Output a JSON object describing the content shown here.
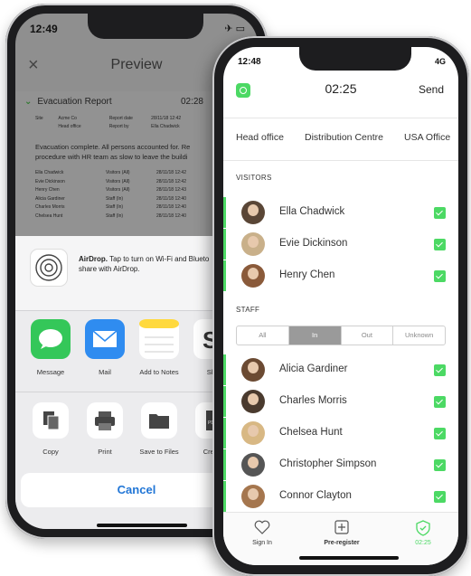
{
  "back_phone": {
    "status_time": "12:49",
    "status_right": "✈ ▭",
    "header": {
      "close": "×",
      "title": "Preview"
    },
    "report": {
      "title": "Evacuation Report",
      "time": "02:28",
      "meta": {
        "site_label": "Site",
        "site_value": "Acme Co",
        "report_date_label": "Report date",
        "report_date": "28/11/18 12:42",
        "office": "Head office",
        "reported_by_label": "Report by",
        "reported_by": "Ella Chadwick"
      },
      "summary_line1": "Evacuation complete. All persons accounted for. Re",
      "summary_line2": "procedure with HR team as slow to leave the buildi",
      "entries": [
        {
          "name": "Ella Chadwick",
          "type": "Visitors (All)",
          "time": "28/11/18 12:42"
        },
        {
          "name": "Evie Dickinson",
          "type": "Visitors (All)",
          "time": "28/11/18 12:42"
        },
        {
          "name": "Henry Chen",
          "type": "Visitors (All)",
          "time": "28/11/18 12:43"
        },
        {
          "name": "Alicia Gardiner",
          "type": "Staff (In)",
          "time": "28/11/18 12:40"
        },
        {
          "name": "Charles Morris",
          "type": "Staff (In)",
          "time": "28/11/18 12:40"
        },
        {
          "name": "Chelsea Hunt",
          "type": "Staff (In)",
          "time": "28/11/18 12:40"
        }
      ]
    },
    "airdrop": {
      "title": "AirDrop.",
      "text": "Tap to turn on Wi-Fi and Blueto",
      "text2": "share with AirDrop."
    },
    "apps": [
      {
        "label": "Message",
        "color": "#34c759"
      },
      {
        "label": "Mail",
        "color": "#2f8cf0"
      },
      {
        "label": "Add to Notes",
        "color": "#ffffff"
      },
      {
        "label": "Slac",
        "color": "#ffffff"
      }
    ],
    "actions": [
      {
        "label": "Copy"
      },
      {
        "label": "Print"
      },
      {
        "label": "Save to Files"
      },
      {
        "label": "Create"
      }
    ],
    "cancel": "Cancel"
  },
  "front_phone": {
    "status_time": "12:48",
    "status_right": "4G",
    "timer": "02:25",
    "send": "Send",
    "tabs": [
      "Head office",
      "Distribution Centre",
      "USA Office"
    ],
    "visitors_heading": "VISITORS",
    "visitors": [
      {
        "name": "Ella Chadwick"
      },
      {
        "name": "Evie Dickinson"
      },
      {
        "name": "Henry Chen"
      }
    ],
    "staff_heading": "STAFF",
    "segments": [
      "All",
      "In",
      "Out",
      "Unknown"
    ],
    "staff": [
      {
        "name": "Alicia Gardiner"
      },
      {
        "name": "Charles Morris"
      },
      {
        "name": "Chelsea Hunt"
      },
      {
        "name": "Christopher Simpson"
      },
      {
        "name": "Connor Clayton"
      }
    ],
    "nav": [
      {
        "label": "Sign In"
      },
      {
        "label": "Pre-register"
      },
      {
        "label": "02:25"
      }
    ],
    "colors": {
      "accent_green": "#4cd964",
      "cancel_blue": "#2176d6"
    }
  }
}
